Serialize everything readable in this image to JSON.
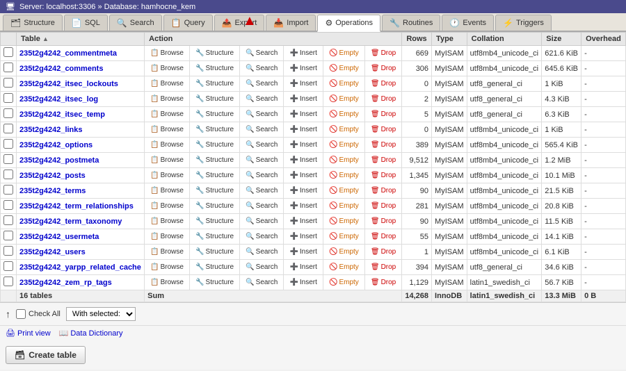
{
  "titleBar": {
    "icon": "🖥",
    "text": "Server: localhost:3306 » Database: hamhocne_kem"
  },
  "navTabs": [
    {
      "id": "structure",
      "icon": "🗂",
      "label": "Structure",
      "active": false
    },
    {
      "id": "sql",
      "icon": "📄",
      "label": "SQL",
      "active": false
    },
    {
      "id": "search",
      "icon": "🔍",
      "label": "Search",
      "active": false
    },
    {
      "id": "query",
      "icon": "📋",
      "label": "Query",
      "active": false
    },
    {
      "id": "export",
      "icon": "📤",
      "label": "Export",
      "active": false
    },
    {
      "id": "import",
      "icon": "📥",
      "label": "Import",
      "active": false
    },
    {
      "id": "operations",
      "icon": "⚙",
      "label": "Operations",
      "active": true
    },
    {
      "id": "routines",
      "icon": "🔧",
      "label": "Routines",
      "active": false
    },
    {
      "id": "events",
      "icon": "🕐",
      "label": "Events",
      "active": false
    },
    {
      "id": "triggers",
      "icon": "⚡",
      "label": "Triggers",
      "active": false
    }
  ],
  "tableHeaders": [
    "",
    "Table",
    "Action",
    "",
    "",
    "",
    "",
    "",
    "",
    "Rows",
    "Type",
    "Collation",
    "Size",
    "Overhead"
  ],
  "tables": [
    {
      "name": "235t2g4242_commentmeta",
      "rows": "669",
      "type": "MyISAM",
      "collation": "utf8mb4_unicode_ci",
      "size": "621.6 KiB",
      "overhead": "-"
    },
    {
      "name": "235t2g4242_comments",
      "rows": "306",
      "type": "MyISAM",
      "collation": "utf8mb4_unicode_ci",
      "size": "645.6 KiB",
      "overhead": "-"
    },
    {
      "name": "235t2g4242_itsec_lockouts",
      "rows": "0",
      "type": "MyISAM",
      "collation": "utf8_general_ci",
      "size": "1 KiB",
      "overhead": "-"
    },
    {
      "name": "235t2g4242_itsec_log",
      "rows": "2",
      "type": "MyISAM",
      "collation": "utf8_general_ci",
      "size": "4.3 KiB",
      "overhead": "-"
    },
    {
      "name": "235t2g4242_itsec_temp",
      "rows": "5",
      "type": "MyISAM",
      "collation": "utf8_general_ci",
      "size": "6.3 KiB",
      "overhead": "-"
    },
    {
      "name": "235t2g4242_links",
      "rows": "0",
      "type": "MyISAM",
      "collation": "utf8mb4_unicode_ci",
      "size": "1 KiB",
      "overhead": "-"
    },
    {
      "name": "235t2g4242_options",
      "rows": "389",
      "type": "MyISAM",
      "collation": "utf8mb4_unicode_ci",
      "size": "565.4 KiB",
      "overhead": "-"
    },
    {
      "name": "235t2g4242_postmeta",
      "rows": "9,512",
      "type": "MyISAM",
      "collation": "utf8mb4_unicode_ci",
      "size": "1.2 MiB",
      "overhead": "-"
    },
    {
      "name": "235t2g4242_posts",
      "rows": "1,345",
      "type": "MyISAM",
      "collation": "utf8mb4_unicode_ci",
      "size": "10.1 MiB",
      "overhead": "-"
    },
    {
      "name": "235t2g4242_terms",
      "rows": "90",
      "type": "MyISAM",
      "collation": "utf8mb4_unicode_ci",
      "size": "21.5 KiB",
      "overhead": "-"
    },
    {
      "name": "235t2g4242_term_relationships",
      "rows": "281",
      "type": "MyISAM",
      "collation": "utf8mb4_unicode_ci",
      "size": "20.8 KiB",
      "overhead": "-"
    },
    {
      "name": "235t2g4242_term_taxonomy",
      "rows": "90",
      "type": "MyISAM",
      "collation": "utf8mb4_unicode_ci",
      "size": "11.5 KiB",
      "overhead": "-"
    },
    {
      "name": "235t2g4242_usermeta",
      "rows": "55",
      "type": "MyISAM",
      "collation": "utf8mb4_unicode_ci",
      "size": "14.1 KiB",
      "overhead": "-"
    },
    {
      "name": "235t2g4242_users",
      "rows": "1",
      "type": "MyISAM",
      "collation": "utf8mb4_unicode_ci",
      "size": "6.1 KiB",
      "overhead": "-"
    },
    {
      "name": "235t2g4242_yarpp_related_cache",
      "rows": "394",
      "type": "MyISAM",
      "collation": "utf8_general_ci",
      "size": "34.6 KiB",
      "overhead": "-"
    },
    {
      "name": "235t2g4242_zem_rp_tags",
      "rows": "1,129",
      "type": "MyISAM",
      "collation": "latin1_swedish_ci",
      "size": "56.7 KiB",
      "overhead": "-"
    }
  ],
  "footer": {
    "tableCount": "16 tables",
    "sumLabel": "Sum",
    "totalRows": "14,268",
    "totalType": "InnoDB",
    "totalCollation": "latin1_swedish_ci",
    "totalSize": "13.3 MiB",
    "totalOverhead": "0 B"
  },
  "bottomBar": {
    "checkAllLabel": "Check All",
    "withSelectedLabel": "With selected:",
    "selectPlaceholder": "With selected:"
  },
  "toolsBar": {
    "printViewLabel": "Print view",
    "dataDictionaryLabel": "Data Dictionary"
  },
  "createTable": {
    "label": "Create table"
  },
  "actions": {
    "browse": "Browse",
    "structure": "Structure",
    "search": "Search",
    "insert": "Insert",
    "empty": "Empty",
    "drop": "Drop"
  }
}
